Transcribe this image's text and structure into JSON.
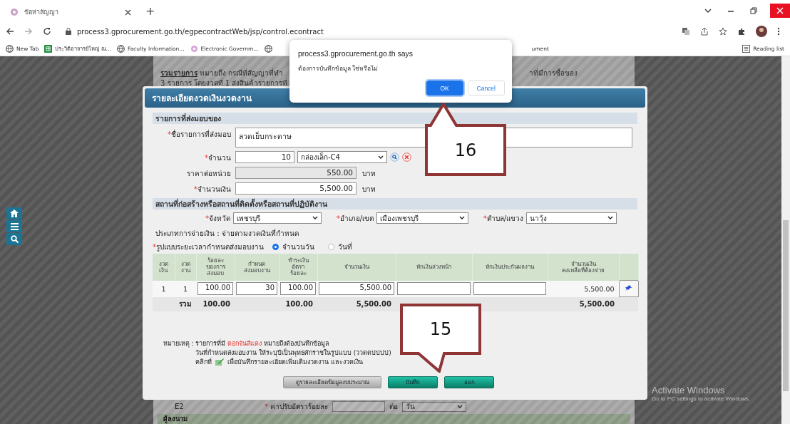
{
  "browser": {
    "tab_title": "ข้อห่าสัญญา",
    "new_tab": "+",
    "url": "process3.gprocurement.go.th/egpecontractWeb/jsp/control.econtract",
    "bookmarks": [
      {
        "label": "New Tab",
        "kind": "globe"
      },
      {
        "label": "ประวิติอาจารย์ใหญ่ ณ...",
        "kind": "sheet"
      },
      {
        "label": "Faculty Information...",
        "kind": "globe"
      },
      {
        "label": "Electronic Governm...",
        "kind": "logo"
      },
      {
        "label": "ument",
        "kind": "globe"
      }
    ],
    "reading_list": "Reading list"
  },
  "background_page": {
    "lines": [
      {
        "term": "รวมรายการ",
        "text": " หมายถึง กรณีที่สัญญาที่ทำ",
        "aside": "าที่มีการซื้อของ"
      },
      {
        "text": "3 รายการ โดยงวดที่ 1 ส่งสินค้ารายการที่"
      }
    ],
    "penalty_row": {
      "code": "E2",
      "label": "ค่าปรับอัตราร้อยละ",
      "per": "ต่อ",
      "unit": "วัน"
    },
    "signer_heading": "ผู้ลงนาม"
  },
  "required_mark": "*",
  "modal": {
    "title": "รายละเอียดงวดเงินงวดงาน",
    "delivery": {
      "heading": "รายการที่ส่งมอบของ",
      "item_name": {
        "label": "ชื่อรายการที่ส่งมอบ",
        "required": true,
        "value": "ลวดเย็บกระดาษ"
      },
      "quantity": {
        "label": "จำนวน",
        "required": true,
        "value": "10",
        "unit": "กล่องเล็ก-C4"
      },
      "unit_price": {
        "label": "ราคาต่อหน่วย",
        "required": false,
        "value": "550.00",
        "currency": "บาท",
        "disabled": true
      },
      "amount": {
        "label": "จำนวนเงิน",
        "required": true,
        "value": "5,500.00",
        "currency": "บาท",
        "disabled": false
      }
    },
    "location": {
      "heading": "สถานที่ก่อสร้างหรือสถานที่ติดตั้งหรือสถานที่ปฏิบัติงาน",
      "selects": [
        {
          "label": "จังหวัด",
          "required": true,
          "value": "เพชรบุรี"
        },
        {
          "label": "อำเภอ/เขต",
          "required": true,
          "value": "เมืองเพชรบุรี"
        },
        {
          "label": "ตำบล/แขวง",
          "required": true,
          "value": "นาวุ้ง"
        }
      ],
      "payment_type": "ประเภทการจ่ายเงิน : จ่ายตามงวดเงินที่กำหนด",
      "schedule": {
        "label": "รูปแบบระยะเวลากำหนดส่งมอบงาน",
        "required": true,
        "options": [
          {
            "label": "จำนวนวัน",
            "selected": true
          },
          {
            "label": "วันที่",
            "selected": false
          }
        ]
      }
    },
    "table": {
      "columns": [
        "งวด\nเงิน",
        "งวด\nงาน",
        "ร้อยละ\nของการ\nส่งมอบ",
        "กำหนด\nส่งมอบงาน",
        "ชำระเงิน\nอัตรา\nร้อยละ",
        "จำนวนเงิน",
        "หักเงินล่วงหน้า",
        "หักเงินประกันผลงาน",
        "จำนวนเงิน\nคงเหลือที่ต้องจ่าย"
      ],
      "rows": [
        {
          "cells": [
            {
              "kind": "text",
              "value": "1"
            },
            {
              "kind": "text",
              "value": "1"
            },
            {
              "kind": "input",
              "value": "100.00"
            },
            {
              "kind": "input",
              "value": "30"
            },
            {
              "kind": "input",
              "value": "100.00"
            },
            {
              "kind": "input",
              "value": "5,500.00"
            },
            {
              "kind": "locked"
            },
            {
              "kind": "locked"
            },
            {
              "kind": "text",
              "value": "5,500.00"
            },
            {
              "kind": "pin"
            }
          ]
        }
      ],
      "total": {
        "cells": [
          {
            "kind": "blank"
          },
          {
            "kind": "text",
            "value": "รวม"
          },
          {
            "kind": "text",
            "value": "100.00"
          },
          {
            "kind": "blank"
          },
          {
            "kind": "text",
            "value": "100.00"
          },
          {
            "kind": "text",
            "value": "5,500.00"
          },
          {
            "kind": "blank"
          },
          {
            "kind": "blank"
          },
          {
            "kind": "text",
            "value": "5,500.00"
          },
          {
            "kind": "blank"
          }
        ]
      }
    },
    "notes": {
      "label": "หมายเหตุ :",
      "lines": [
        {
          "parts": [
            {
              "text": "รายการที่มี "
            },
            {
              "text": "ดอกจันสีแดง",
              "highlight": true
            },
            {
              "text": " หมายถึงต้องบันทึกข้อมูล"
            }
          ]
        },
        {
          "parts": [
            {
              "text": "วันที่กำหนดส่งมอบงาน ให้ระบุปีเป็นพุทธศักราชในรูปแบบ (ววดดปปปป)"
            }
          ]
        },
        {
          "parts": [
            {
              "text": "คลิกที่"
            },
            {
              "kind": "icon"
            },
            {
              "text": "เพื่อบันทึกรายละเอียดเพิ่มเติมงวดงาน และงวดเงิน"
            }
          ]
        }
      ]
    },
    "buttons": [
      {
        "label": "ดูรายละเอียดข้อมูลงบประมาณ",
        "kind": "secondary"
      },
      {
        "label": "บันทึก",
        "kind": "primary"
      },
      {
        "label": "ออก",
        "kind": "primary"
      }
    ]
  },
  "alert": {
    "origin": "process3.gprocurement.go.th says",
    "message": "ต้องการบันทึกข้อมูล ใช่หรือไม่",
    "buttons": [
      {
        "label": "OK",
        "selected": true
      },
      {
        "label": "Cancel",
        "selected": false
      }
    ]
  },
  "callouts": [
    {
      "number": "16",
      "kind": "pointer-up"
    },
    {
      "number": "15",
      "kind": "pointer-down"
    }
  ],
  "os_notice": {
    "title": "Activate Windows",
    "subtitle": "Go to PC settings to activate Windows."
  }
}
